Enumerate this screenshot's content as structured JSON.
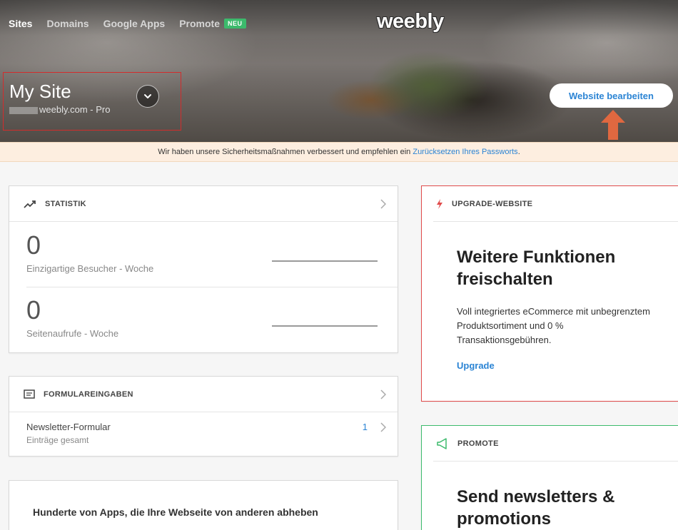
{
  "nav": {
    "items": [
      {
        "label": "Sites",
        "active": true
      },
      {
        "label": "Domains"
      },
      {
        "label": "Google Apps"
      },
      {
        "label": "Promote"
      }
    ],
    "badge": "NEU"
  },
  "logo": "weebly",
  "site": {
    "name": "My Site",
    "url": "weebly.com - Pro"
  },
  "edit_button": "Website bearbeiten",
  "banner": {
    "text": "Wir haben unsere Sicherheitsmaßnahmen verbessert und empfehlen ein ",
    "link": "Zurücksetzen Ihres Passworts",
    "suffix": "."
  },
  "stats": {
    "title": "STATISTIK",
    "items": [
      {
        "value": "0",
        "label": "Einzigartige Besucher - Woche"
      },
      {
        "value": "0",
        "label": "Seitenaufrufe - Woche"
      }
    ]
  },
  "forms": {
    "title": "FORMULAREINGABEN",
    "row": {
      "name": "Newsletter-Formular",
      "sub": "Einträge gesamt",
      "count": "1"
    }
  },
  "apps": {
    "title": "Hunderte von Apps, die Ihre Webseite von anderen abheben"
  },
  "upgrade": {
    "title": "UPGRADE-WEBSITE",
    "heading_line1": "Weitere Funktionen",
    "heading_line2": "freischalten",
    "body_line1": "Voll integriertes eCommerce mit unbegrenztem",
    "body_line2": "Produktsortiment und 0 %",
    "body_line3": "Transaktionsgebühren.",
    "link": "Upgrade"
  },
  "promote": {
    "title": "PROMOTE",
    "heading_line1": "Send newsletters &",
    "heading_line2": "promotions"
  },
  "colors": {
    "accent": "#2b84d4",
    "upgrade_border": "#e04a4a",
    "promote_border": "#3cba6c",
    "badge": "#3cba6c",
    "arrow": "#e06840"
  }
}
